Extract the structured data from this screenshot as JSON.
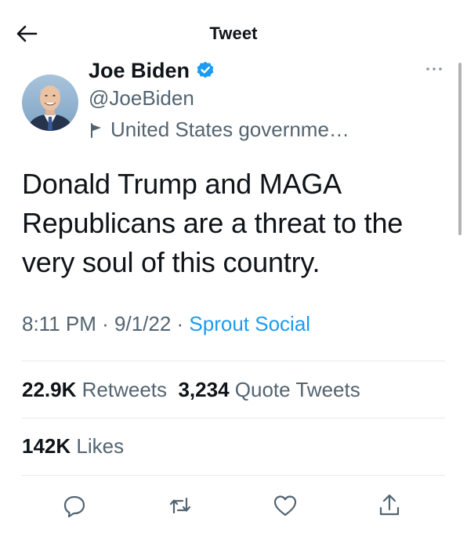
{
  "header": {
    "title": "Tweet",
    "back_icon": "arrow-left-icon"
  },
  "author": {
    "display_name": "Joe Biden",
    "handle": "@JoeBiden",
    "affiliation": "United States governme…",
    "verified_icon": "verified-badge-icon",
    "affiliation_icon": "flag-icon",
    "accent_color": "#1d9bf0"
  },
  "tweet": {
    "text": "Donald Trump and MAGA Republicans are a threat to the very soul of this country.",
    "time": "8:11 PM",
    "date": "9/1/22",
    "separator": " · ",
    "source": "Sprout Social"
  },
  "stats": {
    "retweets_count": "22.9K",
    "retweets_label": "Retweets",
    "quotes_count": "3,234",
    "quotes_label": "Quote Tweets",
    "likes_count": "142K",
    "likes_label": "Likes"
  },
  "actions": [
    "reply-icon",
    "retweet-icon",
    "like-icon",
    "share-icon"
  ]
}
